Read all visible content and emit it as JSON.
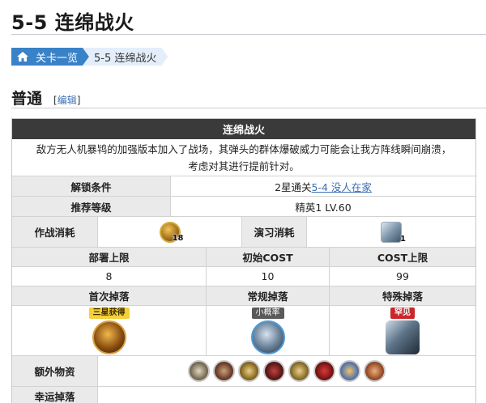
{
  "page": {
    "title": "5-5 连绵战火"
  },
  "breadcrumb": {
    "first": "关卡一览",
    "second": "5-5 连绵战火"
  },
  "section": {
    "title": "普通",
    "edit_open": "[",
    "edit_label": "编辑",
    "edit_close": "]"
  },
  "stage": {
    "name": "连绵战火",
    "desc_line1": "敌方无人机暴鸨的加强版本加入了战场，其弹头的群体爆破威力可能会让我方阵线瞬间崩溃，",
    "desc_line2": "考虑对其进行提前针对。",
    "unlock_label": "解锁条件",
    "unlock_prefix": "2星通关",
    "unlock_link": "5-4 没人在家",
    "level_label": "推荐等级",
    "level_value": "精英1 LV.60",
    "cost_label": "作战消耗",
    "cost_qty": "18",
    "practice_label": "演习消耗",
    "practice_qty": "1",
    "deploy_label": "部署上限",
    "deploy_value": "8",
    "init_cost_label": "初始COST",
    "init_cost_value": "10",
    "max_cost_label": "COST上限",
    "max_cost_value": "99",
    "first_drop_label": "首次掉落",
    "first_drop_badge": "三星获得",
    "normal_drop_label": "常规掉落",
    "normal_drop_badge": "小概率",
    "special_drop_label": "特殊掉落",
    "special_drop_badge": "罕见",
    "extra_label": "额外物资",
    "next_label": "幸运掉落"
  },
  "colors": {
    "accent": "#3a82c8",
    "header_bg": "#3a3a3a",
    "label_bg": "#eaeaea",
    "link": "#3a6fb5"
  }
}
